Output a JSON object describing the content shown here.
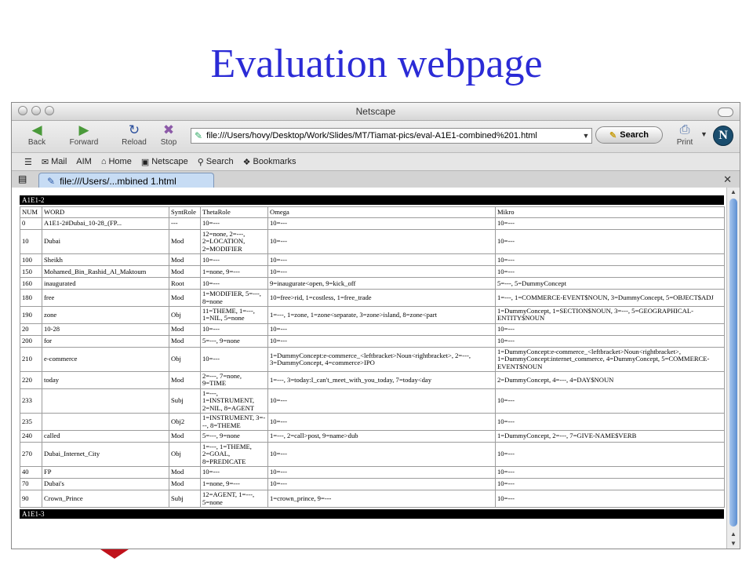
{
  "slide": {
    "title": "Evaluation webpage"
  },
  "window": {
    "title": "Netscape"
  },
  "toolbar": {
    "back": "Back",
    "forward": "Forward",
    "reload": "Reload",
    "stop": "Stop",
    "address": "file:///Users/hovy/Desktop/Work/Slides/MT/Tiamat-pics/eval-A1E1-combined%201.html",
    "search": "Search",
    "print": "Print",
    "logo": "N"
  },
  "bookmarks": {
    "mail": "Mail",
    "aim": "AIM",
    "home": "Home",
    "netscape": "Netscape",
    "search": "Search",
    "bookmarks": "Bookmarks"
  },
  "tab": {
    "label": "file:///Users/...mbined 1.html"
  },
  "table": {
    "section_top": "A1E1-2",
    "section_bottom": "A1E1-3",
    "headers": [
      "NUM",
      "WORD",
      "SyntRole",
      "ThetaRole",
      "Omega",
      "Mikro"
    ],
    "rows": [
      [
        "0",
        "A1E1-2#Dubai_10-28_(FP...",
        "---",
        "10=---",
        "10=---",
        "10=---"
      ],
      [
        "10",
        "Dubai",
        "Mod",
        "12=none, 2=---, 2=LOCATION, 2=MODIFIER",
        "10=---",
        "10=---"
      ],
      [
        "100",
        "Sheikh",
        "Mod",
        "10=---",
        "10=---",
        "10=---"
      ],
      [
        "150",
        "Mohamed_Bin_Rashid_Al_Maktoum",
        "Mod",
        "1=none, 9=---",
        "10=---",
        "10=---"
      ],
      [
        "160",
        "inaugurated",
        "Root",
        "10=---",
        "9=inaugurate<open, 9=kick_off",
        "5=---, 5=DummyConcept"
      ],
      [
        "180",
        "free",
        "Mod",
        "1=MODIFIER, 5=---, 8=none",
        "10=free>rid, 1=costless, 1=free_trade",
        "1=---, 1=COMMERCE-EVENT$NOUN, 3=DummyConcept, 5=OBJECT$ADJ"
      ],
      [
        "190",
        "zone",
        "Obj",
        "11=THEME, 1=---, 1=NIL, 5=none",
        "1=---, 1=zone, 1=zone<separate, 3=zone>island, 8=zone<part",
        "1=DummyConcept, 1=SECTION$NOUN, 3=---, 5=GEOGRAPHICAL-ENTITY$NOUN"
      ],
      [
        "20",
        "10-28",
        "Mod",
        "10=---",
        "10=---",
        "10=---"
      ],
      [
        "200",
        "for",
        "Mod",
        "5=---, 9=none",
        "10=---",
        "10=---"
      ],
      [
        "210",
        "e-commerce",
        "Obj",
        "10=---",
        "1=DummyConcept:e-commerce_<leftbracket>Noun<rightbracket>, 2=---, 3=DummyConcept, 4=commerce>IPO",
        "1=DummyConcept:e-commerce_<leftbracket>Noun<rightbracket>, 1=DummyConcept:internet_commerce, 4=DummyConcept, 5=COMMERCE-EVENT$NOUN"
      ],
      [
        "220",
        "today",
        "Mod",
        "2=---, 7=none, 9=TIME",
        "1=---, 3=today:I_can't_meet_with_you_today, 7=today<day",
        "2=DummyConcept, 4=---, 4=DAY$NOUN"
      ],
      [
        "233",
        "",
        "Subj",
        "1=---, 1=INSTRUMENT, 2=NIL, 8=AGENT",
        "10=---",
        "10=---"
      ],
      [
        "235",
        "",
        "Obj2",
        "1=INSTRUMENT, 3=---, 8=THEME",
        "10=---",
        "10=---"
      ],
      [
        "240",
        "called",
        "Mod",
        "5=---, 9=none",
        "1=---, 2=call>post, 9=name>dub",
        "1=DummyConcept, 2=---, 7=GIVE-NAME$VERB"
      ],
      [
        "270",
        "Dubai_Internet_City",
        "Obj",
        "1=---, 1=THEME, 2=GOAL, 8=PREDICATE",
        "10=---",
        "10=---"
      ],
      [
        "40",
        "FP",
        "Mod",
        "10=---",
        "10=---",
        "10=---"
      ],
      [
        "70",
        "Dubai's",
        "Mod",
        "1=none, 9=---",
        "10=---",
        "10=---"
      ],
      [
        "90",
        "Crown_Prince",
        "Subj",
        "12=AGENT, 1=---, 5=none",
        "1=crown_prince, 9=---",
        "10=---"
      ]
    ]
  }
}
